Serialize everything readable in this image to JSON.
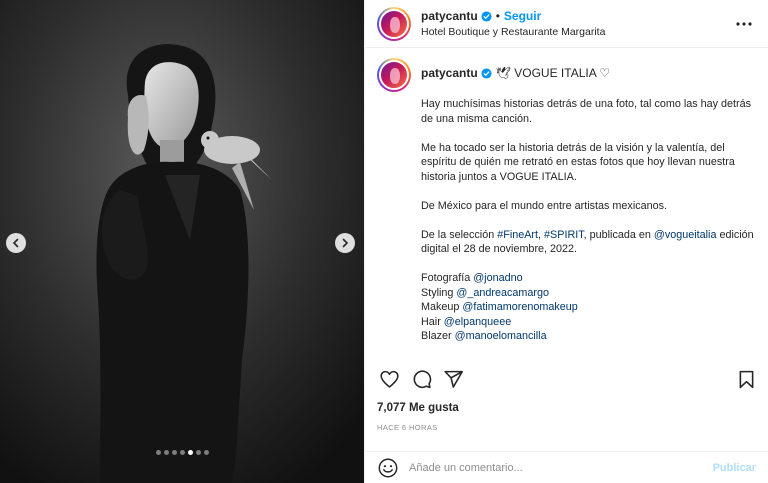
{
  "post": {
    "username": "patycantu",
    "follow_label": "Seguir",
    "location": "Hotel Boutique y Restaurante Margarita",
    "more_icon": "more-horizontal-icon",
    "media": {
      "slide_count": 7,
      "active_slide": 5,
      "prev_icon": "chevron-left-icon",
      "next_icon": "chevron-right-icon"
    },
    "caption": {
      "username": "patycantu",
      "title_suffix": "🕊 VOGUE ITALIA ♡",
      "p1": "Hay muchísimas historias detrás de una foto, tal como las hay detrás de una misma canción.",
      "p2": "Me ha tocado ser la historia detrás de la visión y la valentía, del espíritu de quién me retrató en estas fotos que hoy llevan nuestra historia juntos a VOGUE ITALIA.",
      "p3": "De México para el mundo entre artistas mexicanos.",
      "p4_a": "De la selección ",
      "p4_tag1": "#FineArt",
      "p4_b": ", ",
      "p4_tag2": "#SPIRIT",
      "p4_c": ", publicada en ",
      "p4_tag3": "@vogueitalia",
      "p4_d": " edición digital el 28 de noviembre, 2022.",
      "credits": [
        {
          "role": "Fotografía ",
          "handle": "@jonadno"
        },
        {
          "role": "Styling ",
          "handle": "@_andreacamargo"
        },
        {
          "role": "Makeup ",
          "handle": "@fatimamorenomakeup"
        },
        {
          "role": "Hair ",
          "handle": "@elpanqueee"
        },
        {
          "role": "Blazer ",
          "handle": "@manoelomancilla"
        }
      ]
    },
    "actions": {
      "like_icon": "heart-icon",
      "comment_icon": "comment-icon",
      "share_icon": "share-icon",
      "save_icon": "bookmark-icon"
    },
    "likes_count": "7,077",
    "likes_suffix": " Me gusta",
    "timestamp": "HACE 6 HORAS",
    "comment_box": {
      "placeholder": "Añade un comentario...",
      "publish_label": "Publicar",
      "emoji_icon": "emoji-icon"
    }
  },
  "colors": {
    "accent": "#0095f6",
    "tag": "#00376b",
    "publish_disabled": "#b2dffc",
    "muted": "#8e8e8e"
  }
}
